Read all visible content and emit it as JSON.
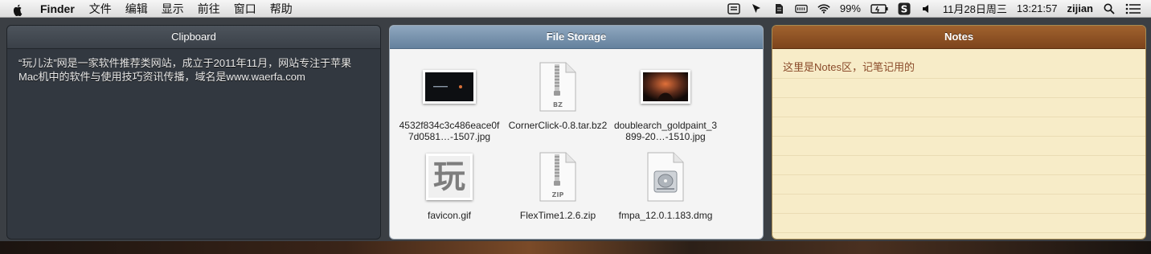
{
  "menubar": {
    "app_name": "Finder",
    "menus": [
      "文件",
      "编辑",
      "显示",
      "前往",
      "窗口",
      "帮助"
    ],
    "battery": "99%",
    "date": "11月28日周三",
    "time": "13:21:57",
    "user": "zijian",
    "status_icons": [
      "shield-icon",
      "cursor-icon",
      "evernote-icon",
      "battery-bar-icon",
      "wifi-icon",
      "battery-icon",
      "s-app-icon",
      "volume-icon"
    ]
  },
  "clipboard": {
    "title": "Clipboard",
    "text": "“玩儿法”网是一家软件推荐类网站，成立于2011年11月，网站专注于苹果Mac机中的软件与使用技巧资讯传播，域名是www.waerfa.com"
  },
  "file_storage": {
    "title": "File Storage",
    "files": [
      {
        "name": "4532f834c3c486eace0f7d0581…-1507.jpg",
        "type": "jpg-dark"
      },
      {
        "name": "CornerClick-0.8.tar.bz2",
        "type": "bz"
      },
      {
        "name": "doublearch_goldpaint_3899-20…-1510.jpg",
        "type": "jpg-arch"
      },
      {
        "name": "favicon.gif",
        "type": "gif",
        "glyph": "玩"
      },
      {
        "name": "FlexTime1.2.6.zip",
        "type": "zip"
      },
      {
        "name": "fmpa_12.0.1.183.dmg",
        "type": "dmg"
      }
    ],
    "labels": {
      "bz": "BZ",
      "zip": "ZIP"
    }
  },
  "notes": {
    "title": "Notes",
    "text": "这里是Notes区，记笔记用的"
  }
}
